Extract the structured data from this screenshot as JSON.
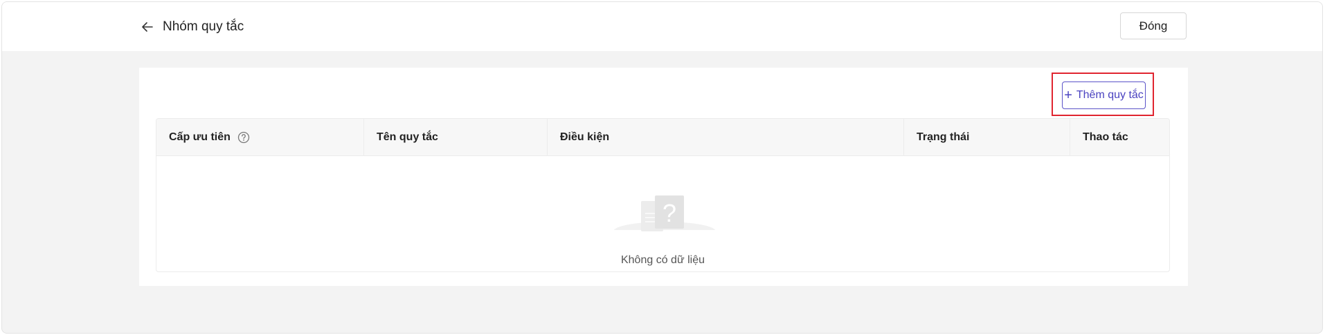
{
  "header": {
    "title": "Nhóm quy tắc",
    "back_icon": "arrow-left-icon",
    "close_label": "Đóng"
  },
  "toolbar": {
    "add_rule_label": "Thêm quy tắc",
    "add_icon": "plus-icon"
  },
  "table": {
    "columns": [
      {
        "label": "Cấp ưu tiên",
        "help_icon": "question-circle-icon"
      },
      {
        "label": "Tên quy tắc"
      },
      {
        "label": "Điều kiện"
      },
      {
        "label": "Trạng thái"
      },
      {
        "label": "Thao tác"
      }
    ],
    "rows": [],
    "empty_text": "Không có dữ liệu",
    "empty_icon": "empty-document-question-icon"
  },
  "colors": {
    "accent": "#4a42c0",
    "highlight": "#e0242f",
    "page_background": "#f3f3f3"
  }
}
